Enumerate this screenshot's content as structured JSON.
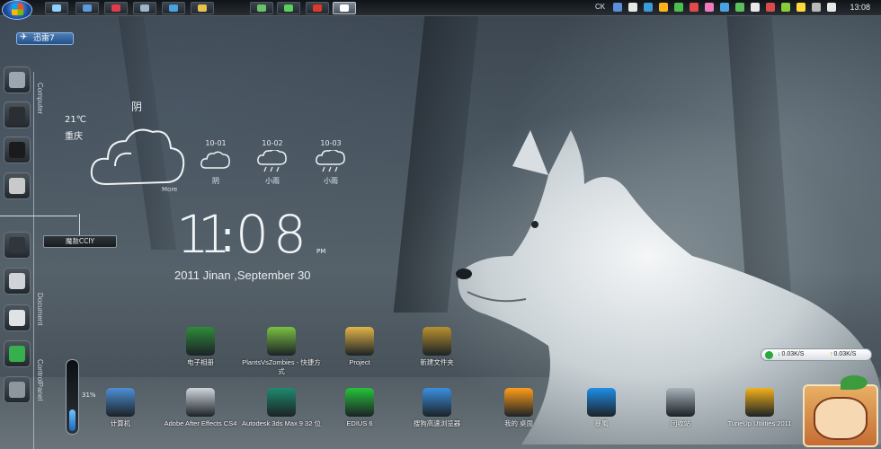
{
  "taskbar": {
    "clock": "13:08",
    "lang": "CK",
    "buttons": [
      {
        "icon": "media-player-icon",
        "color": "#8fd0ff"
      },
      {
        "icon": "app-icon",
        "color": "#5a9bdc"
      },
      {
        "icon": "heart-icon",
        "color": "#e23b4a"
      },
      {
        "icon": "window-icon",
        "color": "#9fb6c9"
      },
      {
        "icon": "chat-icon",
        "color": "#4aa3e0"
      },
      {
        "icon": "folder-icon",
        "color": "#e8c24b"
      },
      {
        "icon": "browser-icon",
        "color": "#6bc167"
      },
      {
        "icon": "edit-icon",
        "color": "#5ad05a"
      },
      {
        "icon": "weibo-icon",
        "color": "#d93a2a"
      },
      {
        "icon": "sogou-browser-icon",
        "color": "#ffffff"
      }
    ]
  },
  "dock": {
    "xunlei_label": "迅雷7",
    "section_computer": "Computer",
    "section_document": "Document",
    "section_control": "ControlPanel",
    "hanging_sign": "魔敖CCIY",
    "items": [
      {
        "icon": "finder-icon",
        "color": "#9aa6b0"
      },
      {
        "icon": "video-chat-icon",
        "color": "#2b2f33"
      },
      {
        "icon": "powerpoint-icon",
        "color": "#1b1b1b"
      },
      {
        "icon": "font-book-icon",
        "color": "#c9c9c9"
      },
      {
        "icon": "camera-icon",
        "color": "#30363c"
      },
      {
        "icon": "dvd-icon",
        "color": "#d0d4d8"
      },
      {
        "icon": "contacts-icon",
        "color": "#dfe3e6"
      },
      {
        "icon": "monitor-icon",
        "color": "#36b04c"
      },
      {
        "icon": "system-prefs-icon",
        "color": "#8d979f"
      }
    ]
  },
  "weather": {
    "temperature": "21℃",
    "city": "重庆",
    "today_condition": "阴",
    "more_label": "More",
    "forecast": [
      {
        "date": "10-01",
        "condition": "阴"
      },
      {
        "date": "10-02",
        "condition": "小雨"
      },
      {
        "date": "10-03",
        "condition": "小雨"
      }
    ]
  },
  "clock": {
    "h1": "1",
    "h2": "1",
    "m1": "0",
    "m2": "8",
    "ampm": "PM",
    "date": "2011 Jinan ,September 30"
  },
  "volume": {
    "percent_label": "31%",
    "level": 0.31
  },
  "desktop_icons": [
    {
      "label": "电子相册",
      "icon": "photo-album-icon",
      "color": "#2e8b3a"
    },
    {
      "label": "PlantsVsZombies - 快捷方式",
      "icon": "plants-vs-zombies-icon",
      "color": "#7bc043"
    },
    {
      "label": "Project",
      "icon": "folder-icon",
      "color": "#e2b548"
    },
    {
      "label": "新建文件夹",
      "icon": "folder-dark-icon",
      "color": "#b8902f"
    },
    {
      "label": "计算机",
      "icon": "computer-icon",
      "color": "#4d8fd6"
    },
    {
      "label": "Adobe After Effects CS4",
      "icon": "after-effects-icon",
      "color": "#cfd6dc"
    },
    {
      "label": "Autodesk 3ds Max 9 32 位",
      "icon": "3ds-max-icon",
      "color": "#1e8a6e"
    },
    {
      "label": "EDIUS 6",
      "icon": "edius-icon",
      "color": "#26c23a"
    },
    {
      "label": "搜狗高速浏览器",
      "icon": "sogou-browser-icon",
      "color": "#3a8fe0"
    },
    {
      "label": "我的 桌面",
      "icon": "my-desktop-icon",
      "color": "#ff9d1a"
    },
    {
      "label": "暴風",
      "icon": "storm-player-icon",
      "color": "#1f8ee8"
    },
    {
      "label": "回收站",
      "icon": "recycle-bin-icon",
      "color": "#a8b3ba"
    },
    {
      "label": "TuneUp Utilities 2011",
      "icon": "tuneup-icon",
      "color": "#f2b21c"
    }
  ],
  "speed_widget": {
    "download": "0.03K/S",
    "upload": "0.03K/S"
  }
}
